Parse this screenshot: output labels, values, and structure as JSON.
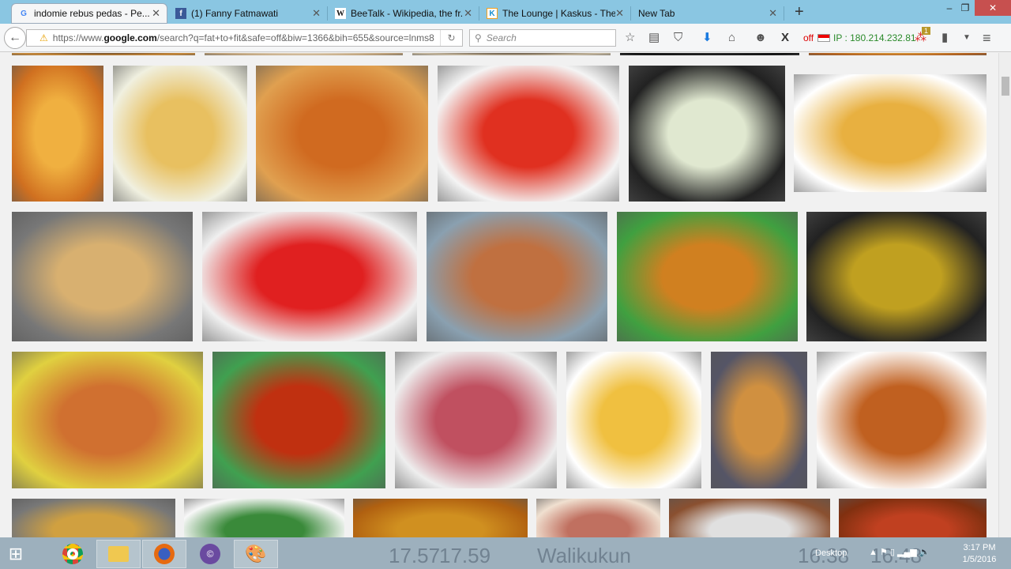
{
  "tabs": [
    {
      "title": "indomie rebus pedas - Pe...",
      "favicon": "G",
      "active": true
    },
    {
      "title": "(1) Fanny Fatmawati",
      "favicon": "f"
    },
    {
      "title": "BeeTalk - Wikipedia, the fr...",
      "favicon": "W"
    },
    {
      "title": "The Lounge | Kaskus - The...",
      "favicon": "K"
    },
    {
      "title": "New Tab",
      "favicon": ""
    }
  ],
  "window": {
    "minimize": "–",
    "restore": "❐",
    "close": "✕"
  },
  "nav": {
    "url_prefix": "https://www.",
    "url_domain": "google.com",
    "url_rest": "/search?q=fat+to+fit&safe=off&biw=1366&bih=655&source=lnms8",
    "search_placeholder": "Search",
    "vpn_status": "off",
    "ip": "IP : 180.214.232.81",
    "badge": "1"
  },
  "images": {
    "row0": [
      [
        "#6b4a2a",
        "#c98a3a"
      ],
      [
        "#e9dcc8",
        "#bfa27a"
      ],
      [
        "#5a4a38",
        "#c7b9a0"
      ],
      [
        "#333",
        "#111"
      ],
      [
        "#e0a040",
        "#b06020"
      ]
    ],
    "row1": [
      [
        "#f0b040",
        "#d07020"
      ],
      [
        "#e8c060",
        "#f0f0e0"
      ],
      [
        "#d06a20",
        "#e0a050"
      ],
      [
        "#e03020",
        "#f4f4f4"
      ],
      [
        "#e0e8d0",
        "#222"
      ],
      [
        "#e8b040",
        "#fff"
      ]
    ],
    "row2": [
      [
        "#d8b070",
        "#777"
      ],
      [
        "#e02020",
        "#f0f0f0"
      ],
      [
        "#c07040",
        "#8aa0b0"
      ],
      [
        "#d08020",
        "#40a040"
      ],
      [
        "#c0a020",
        "#222"
      ]
    ],
    "row3": [
      [
        "#d07030",
        "#e0d040"
      ],
      [
        "#c03010",
        "#40a050"
      ],
      [
        "#c05060",
        "#eee"
      ],
      [
        "#f0c040",
        "#fff"
      ],
      [
        "#d09040",
        "#556"
      ],
      [
        "#c06020",
        "#fff"
      ]
    ],
    "row4": [
      [
        "#d0a040",
        "#777"
      ],
      [
        "#3a8a3a",
        "#f8f8f8"
      ],
      [
        "#d09020",
        "#b06010"
      ],
      [
        "#c07060",
        "#f0e0d0"
      ],
      [
        "#e0e0e0",
        "#8a5030"
      ],
      [
        "#c04020",
        "#803010"
      ]
    ]
  },
  "taskbar": {
    "bg_text": [
      "17.57",
      "17.59",
      "Walikukun",
      "16.38",
      "16.48"
    ],
    "desktop_label": "Desktop",
    "time": "3:17 PM",
    "date": "1/5/2016"
  }
}
